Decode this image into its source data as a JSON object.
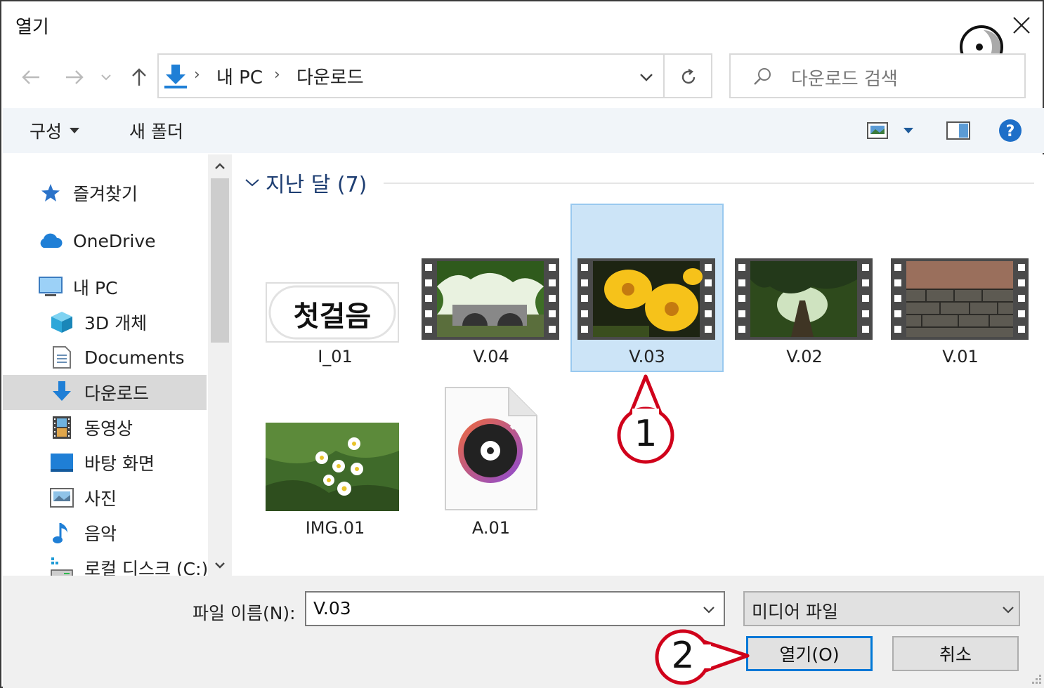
{
  "window": {
    "title": "열기"
  },
  "address": {
    "crumbs": [
      "내 PC",
      "다운로드"
    ]
  },
  "search": {
    "placeholder": "다운로드 검색"
  },
  "toolbar": {
    "organize_label": "구성",
    "new_folder_label": "새 폴더"
  },
  "nav": {
    "items": [
      {
        "label": "즐겨찾기",
        "icon": "star-icon"
      },
      {
        "label": "OneDrive",
        "icon": "cloud-icon"
      },
      {
        "label": "내 PC",
        "icon": "computer-icon"
      },
      {
        "label": "3D 개체",
        "icon": "cube-icon"
      },
      {
        "label": "Documents",
        "icon": "document-icon"
      },
      {
        "label": "다운로드",
        "icon": "download-icon",
        "selected": true
      },
      {
        "label": "동영상",
        "icon": "film-icon"
      },
      {
        "label": "바탕 화면",
        "icon": "desktop-icon"
      },
      {
        "label": "사진",
        "icon": "picture-icon"
      },
      {
        "label": "음악",
        "icon": "music-note-icon"
      },
      {
        "label": "로컬 디스크 (C:)",
        "icon": "drive-icon"
      }
    ]
  },
  "content": {
    "group_label": "지난 달 (7)",
    "files": [
      {
        "name": "I_01",
        "kind": "image",
        "thumb_text": "첫걸음"
      },
      {
        "name": "V.04",
        "kind": "video"
      },
      {
        "name": "V.03",
        "kind": "video",
        "selected": true
      },
      {
        "name": "V.02",
        "kind": "video"
      },
      {
        "name": "V.01",
        "kind": "video"
      },
      {
        "name": "IMG.01",
        "kind": "image"
      },
      {
        "name": "A.01",
        "kind": "audio"
      }
    ]
  },
  "footer": {
    "filename_label": "파일 이름(N):",
    "filename_value": "V.03",
    "filetype_value": "미디어 파일",
    "open_label": "열기(O)",
    "cancel_label": "취소"
  },
  "annotations": {
    "step1": "1",
    "step2": "2"
  },
  "colors": {
    "accent": "#0078d7",
    "annotation": "#d0021b",
    "selection": "#cce4f7"
  }
}
